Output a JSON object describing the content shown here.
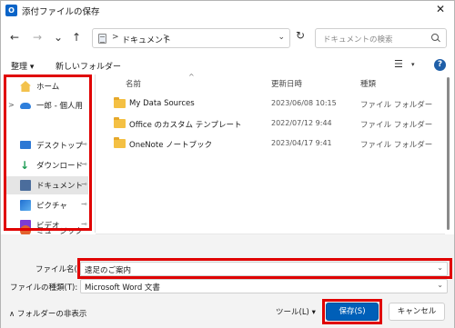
{
  "window": {
    "title": "添付ファイルの保存",
    "app_icon_letter": "O",
    "close_glyph": "✕"
  },
  "nav": {
    "back": "←",
    "forward": "→",
    "up": "↑",
    "refresh": "↻"
  },
  "address": {
    "separator": ">",
    "crumb": "ドキュメント"
  },
  "search": {
    "placeholder": "ドキュメントの検索"
  },
  "toolbar": {
    "organize": "整理 ▾",
    "new_folder": "新しいフォルダー",
    "view_icon": "☰",
    "view_caret": "▾",
    "help": "?"
  },
  "sidebar": {
    "items": [
      {
        "label": "ホーム",
        "icon": "home-icon"
      },
      {
        "label": "一郎 - 個人用",
        "icon": "onedrive-icon"
      },
      {
        "label": "デスクトップ",
        "icon": "desktop-icon"
      },
      {
        "label": "ダウンロード",
        "icon": "download-icon"
      },
      {
        "label": "ドキュメント",
        "icon": "documents-icon"
      },
      {
        "label": "ピクチャ",
        "icon": "pictures-icon"
      },
      {
        "label": "ビデオ",
        "icon": "video-icon"
      },
      {
        "label": "ミュージック",
        "icon": "music-icon"
      }
    ],
    "expand_glyph": ">",
    "pin_glyph": "📌"
  },
  "file_list": {
    "columns": [
      "名前",
      "更新日時",
      "種類"
    ],
    "sort_indicator": "^",
    "rows": [
      {
        "name": "My Data Sources",
        "modified": "2023/06/08 10:15",
        "type": "ファイル フォルダー"
      },
      {
        "name": "Office のカスタム テンプレート",
        "modified": "2022/07/12 9:44",
        "type": "ファイル フォルダー"
      },
      {
        "name": "OneNote ノートブック",
        "modified": "2023/04/17 9:41",
        "type": "ファイル フォルダー"
      }
    ]
  },
  "form": {
    "filename_label": "ファイル名(N):",
    "filename_value": "遠足のご案内",
    "filetype_label": "ファイルの種類(T):",
    "filetype_value": "Microsoft Word 文書",
    "dropdown_glyph": "⌄"
  },
  "footer": {
    "hide_folders": "∧  フォルダーの非表示",
    "tools": "ツール(L)   ▾",
    "save": "保存(S)",
    "cancel": "キャンセル"
  },
  "colors": {
    "highlight_box": "#e00000",
    "save_button": "#005fb8",
    "folder": "#f4c043"
  }
}
